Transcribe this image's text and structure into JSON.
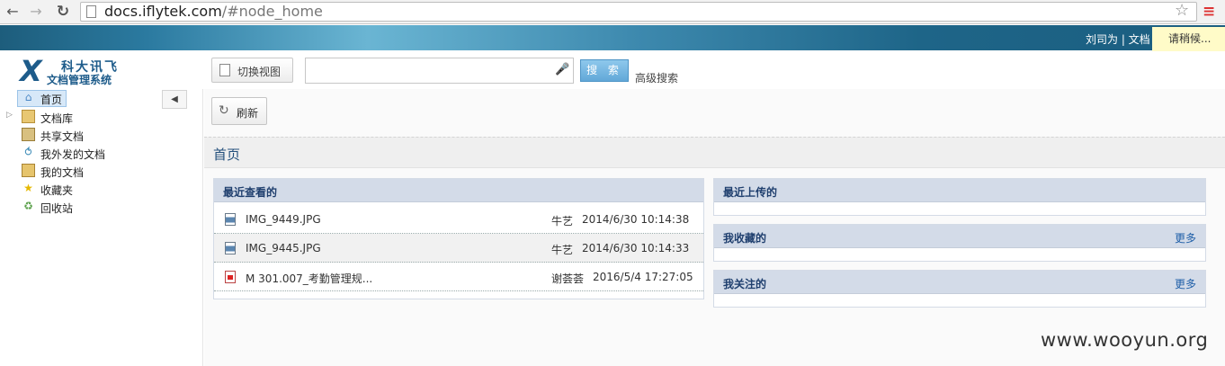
{
  "browser": {
    "url_host": "docs.iflytek.com",
    "url_rest": "/#node_home"
  },
  "header": {
    "user_info": "刘司为 | 文档",
    "loading_text": "请稍候..."
  },
  "logo": {
    "brand_cn": "科大讯飞",
    "system_name": "文档管理系统"
  },
  "toolbar": {
    "switch_view_label": "切换视图",
    "search_placeholder": "",
    "search_button_label": "搜 索",
    "advanced_search_label": "高级搜索"
  },
  "sidebar": {
    "items": [
      {
        "label": "首页",
        "icon": "home-icon"
      },
      {
        "label": "文档库",
        "icon": "library-icon"
      },
      {
        "label": "共享文档",
        "icon": "shared-icon"
      },
      {
        "label": "我外发的文档",
        "icon": "outgoing-icon"
      },
      {
        "label": "我的文档",
        "icon": "my-docs-icon"
      },
      {
        "label": "收藏夹",
        "icon": "star-icon"
      },
      {
        "label": "回收站",
        "icon": "recycle-bin-icon"
      }
    ]
  },
  "main": {
    "refresh_label": "刷新",
    "page_title": "首页",
    "recent_viewed": {
      "title": "最近查看的",
      "files": [
        {
          "name": "IMG_9449.JPG",
          "user": "牛艺",
          "time": "2014/6/30 10:14:38",
          "type": "image"
        },
        {
          "name": "IMG_9445.JPG",
          "user": "牛艺",
          "time": "2014/6/30 10:14:33",
          "type": "image"
        },
        {
          "name": "M 301.007_考勤管理规...",
          "user": "谢荟荟",
          "time": "2016/5/4 17:27:05",
          "type": "pdf"
        }
      ]
    },
    "recent_uploaded": {
      "title": "最近上传的"
    },
    "my_favorites": {
      "title": "我收藏的",
      "more": "更多"
    },
    "my_follows": {
      "title": "我关注的",
      "more": "更多"
    }
  },
  "watermark": "www.wooyun.org"
}
